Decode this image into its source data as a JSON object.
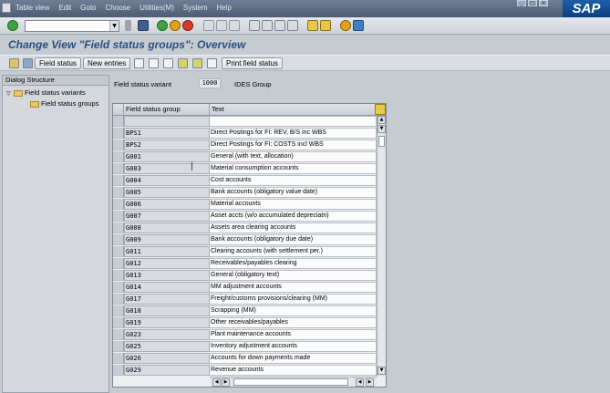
{
  "menu": {
    "items": [
      "Table view",
      "Edit",
      "Goto",
      "Choose",
      "Utilities(M)",
      "System",
      "Help"
    ]
  },
  "logo": "SAP",
  "title": "Change View \"Field status groups\": Overview",
  "app_toolbar": {
    "field_status_label": "Field status",
    "new_entries_label": "New entries",
    "print_field_status_label": "Print field status"
  },
  "dialog_structure": {
    "header": "Dialog Structure",
    "nodes": [
      {
        "label": "Field status variants"
      },
      {
        "label": "Field status groups"
      }
    ]
  },
  "variant": {
    "label": "Field status variant",
    "value": "1000",
    "description": "IDES Group"
  },
  "table": {
    "columns": [
      "Field status group",
      "Text"
    ],
    "rows": [
      {
        "group": "",
        "text": ""
      },
      {
        "group": "BPS1",
        "text": "Direct Postings for FI: REV, B/S inc WBS"
      },
      {
        "group": "BPS2",
        "text": "Direct Postings for FI: COSTS incl WBS"
      },
      {
        "group": "G001",
        "text": "General (with text, allocation)"
      },
      {
        "group": "G003",
        "text": "Material consumption accounts"
      },
      {
        "group": "G004",
        "text": "Cost accounts"
      },
      {
        "group": "G005",
        "text": "Bank accounts (obligatory value date)"
      },
      {
        "group": "G006",
        "text": "Material accounts"
      },
      {
        "group": "G007",
        "text": "Asset accts (w/o accumulated depreciatn)"
      },
      {
        "group": "G008",
        "text": "Assets area clearing accounts"
      },
      {
        "group": "G009",
        "text": "Bank accounts (obligatory due date)"
      },
      {
        "group": "G011",
        "text": "Clearing accounts (with settlement per.)"
      },
      {
        "group": "G012",
        "text": "Receivables/payables clearing"
      },
      {
        "group": "G013",
        "text": "General (obligatory text)"
      },
      {
        "group": "G014",
        "text": "MM adjustment accounts"
      },
      {
        "group": "G017",
        "text": "Freight/customs provisions/clearing (MM)"
      },
      {
        "group": "G018",
        "text": "Scrapping (MM)"
      },
      {
        "group": "G019",
        "text": "Other receivables/payables"
      },
      {
        "group": "G023",
        "text": "Plant maintenance accounts"
      },
      {
        "group": "G025",
        "text": "Inventory adjustment accounts"
      },
      {
        "group": "G026",
        "text": "Accounts for down payments made"
      },
      {
        "group": "G029",
        "text": "Revenue accounts"
      }
    ]
  },
  "colors": {
    "menubar": "#4d5c74",
    "title": "#2c4f7e",
    "logo": "#0c3f82"
  }
}
